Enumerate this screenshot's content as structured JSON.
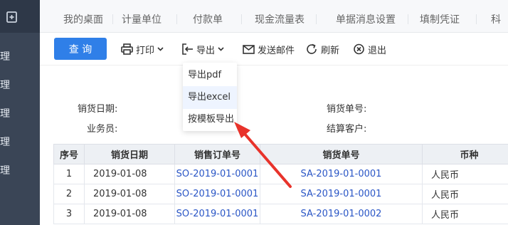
{
  "sidebar": {
    "items": [
      "理",
      "理",
      "理",
      "理",
      "理"
    ]
  },
  "tabs": [
    "我的桌面",
    "计量单位",
    "付款单",
    "现金流量表",
    "单据消息设置",
    "填制凭证",
    "科"
  ],
  "toolbar": {
    "query": "查 询",
    "print": "打印",
    "export": "导出",
    "send_mail": "发送邮件",
    "refresh": "刷新",
    "exit": "退出"
  },
  "export_menu": {
    "items": [
      "导出pdf",
      "导出excel",
      "按模板导出"
    ]
  },
  "form": {
    "sale_date_label": "销货日期:",
    "salesman_label": "业务员:",
    "sale_no_label": "销货单号:",
    "settle_customer_label": "结算客户:"
  },
  "table": {
    "headers": [
      "序号",
      "销货日期",
      "销售订单号",
      "销货单号",
      "币种"
    ],
    "rows": [
      [
        "1",
        "2019-01-08",
        "SO-2019-01-0001",
        "SA-2019-01-0001",
        "人民币"
      ],
      [
        "2",
        "2019-01-08",
        "SO-2019-01-0001",
        "SA-2019-01-0001",
        "人民币"
      ],
      [
        "3",
        "2019-01-08",
        "SO-2019-01-0001",
        "SA-2019-01-0002",
        "人民币"
      ]
    ]
  },
  "colors": {
    "primary": "#2f7fe8",
    "sidebar": "#3a4556",
    "link": "#2a56c6",
    "annotation": "#e8332b"
  }
}
